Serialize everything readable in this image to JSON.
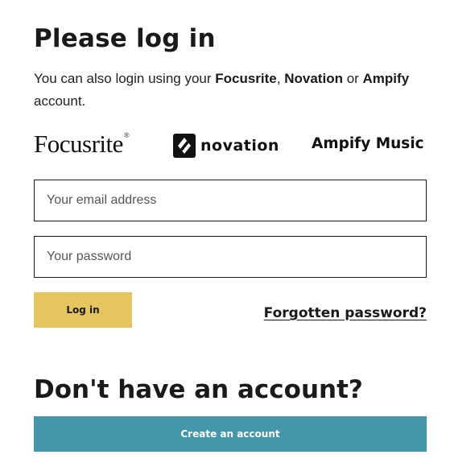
{
  "login": {
    "title": "Please log in",
    "intro": {
      "prefix": "You can also login using your ",
      "brand1": "Focusrite",
      "sep1": ", ",
      "brand2": "Novation",
      "sep2": " or ",
      "brand3": "Ampify",
      "suffix": " account."
    },
    "logos": {
      "focusrite": "Focusrite",
      "focusrite_reg": "®",
      "novation": "novation",
      "ampify": "Ampify Music"
    },
    "email": {
      "placeholder": "Your email address",
      "value": ""
    },
    "password": {
      "placeholder": "Your password",
      "value": ""
    },
    "login_button": "Log in",
    "forgot_link": "Forgotten password?"
  },
  "signup": {
    "title": "Don't have an account?",
    "create_button": "Create an account"
  },
  "colors": {
    "login_button_bg": "#e5c55f",
    "create_button_bg": "#4496a8",
    "text": "#1a1a1a"
  },
  "icons": {
    "novation_mark": "novation-logo-icon"
  }
}
